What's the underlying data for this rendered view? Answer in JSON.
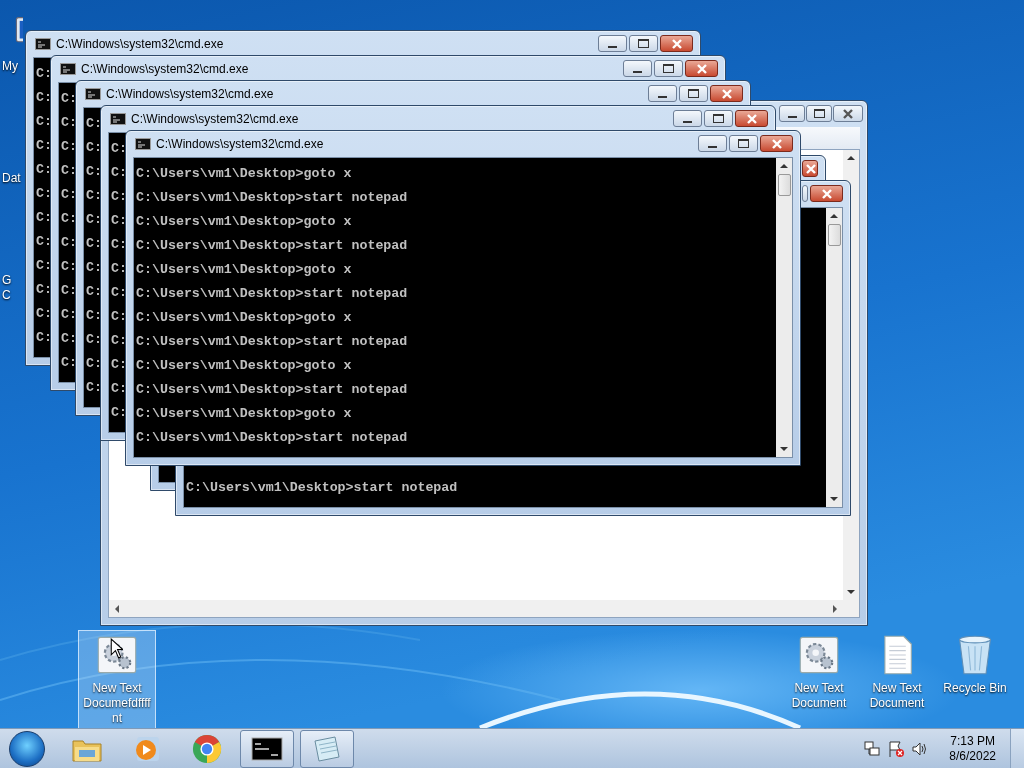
{
  "desktop_icons": [
    {
      "kind": "computer",
      "lines": [
        "My"
      ],
      "selected": false
    },
    {
      "kind": "shortcut",
      "lines": [
        "Dat"
      ],
      "selected": false
    },
    {
      "kind": "browser-shortcut",
      "lines": [
        "G",
        "C"
      ],
      "selected": false
    },
    {
      "kind": "gear-file",
      "lines": [
        "New Text",
        "Documefdffff",
        "nt"
      ],
      "selected": true
    },
    {
      "kind": "gear-file",
      "lines": [
        "New Text",
        "Document"
      ],
      "selected": false
    },
    {
      "kind": "text-file",
      "lines": [
        "New Text",
        "Document"
      ],
      "selected": false
    },
    {
      "kind": "recycle-bin",
      "lines": [
        "Recycle Bin"
      ],
      "selected": false
    }
  ],
  "windows": [
    {
      "kind": "notepad"
    },
    {
      "kind": "console",
      "title": "C:\\Windows\\system32\\cmd.exe",
      "lines": [
        "C:",
        "C:",
        "C:",
        "C:",
        "C:",
        "C:",
        "C:",
        "C:",
        "C:",
        "C:",
        "C:",
        "C:"
      ]
    },
    {
      "kind": "console",
      "title": "C:\\Windows\\system32\\cmd.exe",
      "lines": [
        "C:",
        "C:",
        "C:",
        "C:",
        "C:",
        "C:",
        "C:",
        "C:",
        "C:",
        "C:",
        "C:",
        "C:"
      ]
    },
    {
      "kind": "console",
      "title": "C:\\Windows\\system32\\cmd.exe",
      "lines": [
        "C:",
        "C:",
        "C:",
        "C:",
        "C:",
        "C:",
        "C:",
        "C:",
        "C:",
        "C:",
        "C:",
        "C:"
      ]
    },
    {
      "kind": "console",
      "title": "C:\\Windows\\system32\\cmd.exe",
      "lines": [
        "C:",
        "C:",
        "C:",
        "C:",
        "C:",
        "C:",
        "C:",
        "C:",
        "C:",
        "C:",
        "C:",
        "C:"
      ]
    },
    {
      "kind": "console"
    },
    {
      "kind": "console",
      "lines": [
        "C:\\Users\\vm1\\Desktop>start notepad"
      ]
    },
    {
      "kind": "console",
      "title": "C:\\Windows\\system32\\cmd.exe",
      "lines": [
        "C:\\Users\\vm1\\Desktop>goto x",
        "C:\\Users\\vm1\\Desktop>start notepad",
        "C:\\Users\\vm1\\Desktop>goto x",
        "C:\\Users\\vm1\\Desktop>start notepad",
        "C:\\Users\\vm1\\Desktop>goto x",
        "C:\\Users\\vm1\\Desktop>start notepad",
        "C:\\Users\\vm1\\Desktop>goto x",
        "C:\\Users\\vm1\\Desktop>start notepad",
        "C:\\Users\\vm1\\Desktop>goto x",
        "C:\\Users\\vm1\\Desktop>start notepad",
        "C:\\Users\\vm1\\Desktop>goto x",
        "C:\\Users\\vm1\\Desktop>start notepad"
      ]
    }
  ],
  "taskbar": {
    "items": [
      {
        "kind": "explorer",
        "running": false
      },
      {
        "kind": "media-player",
        "running": false
      },
      {
        "kind": "browser",
        "running": false
      },
      {
        "kind": "console",
        "running": true
      },
      {
        "kind": "notepad",
        "running": true
      }
    ],
    "time": "7:13 PM",
    "date": "8/6/2022"
  }
}
